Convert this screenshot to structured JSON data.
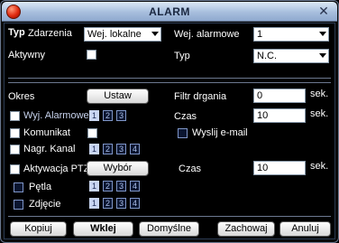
{
  "window": {
    "title": "ALARM"
  },
  "top": {
    "event_type_label_a": "Typ",
    "event_type_label_b": "Zdarzenia",
    "event_type_value": "Wej. lokalne",
    "alarm_input_label": "Wej. alarmowe",
    "alarm_input_value": "1",
    "active_label": "Aktywny",
    "type_label": "Typ",
    "type_value": "N.C."
  },
  "middle": {
    "period_label": "Okres",
    "set_button": "Ustaw",
    "debounce_label": "Filtr drgania",
    "debounce_value": "0",
    "debounce_unit": "sek.",
    "alarm_out_label": "Wyj. Alarmowe",
    "alarm_out_channels": [
      "1",
      "2",
      "3"
    ],
    "time_label": "Czas",
    "time_value": "10",
    "time_unit": "sek.",
    "message_label": "Komunikat",
    "send_email_label": "Wyslij e-mail",
    "record_channel_label": "Nagr. Kanal",
    "record_channels": [
      "1",
      "2",
      "3",
      "4"
    ],
    "ptz_label": "Aktywacja PTZ",
    "select_button": "Wybór",
    "ptz_time_label": "Czas",
    "ptz_time_value": "10",
    "ptz_time_unit": "sek.",
    "tour_label": "Pętla",
    "tour_channels": [
      "1",
      "2",
      "3",
      "4"
    ],
    "snapshot_label": "Zdjęcie",
    "snapshot_channels": [
      "1",
      "2",
      "3",
      "4"
    ]
  },
  "footer": {
    "copy": "Kopiuj",
    "paste": "Wklej",
    "default": "Domyślne",
    "save": "Zachowaj",
    "cancel": "Anuluj"
  },
  "colors": {
    "titlebar": "#a7bedd",
    "background": "#000000",
    "accent": "#c9d6f2"
  }
}
